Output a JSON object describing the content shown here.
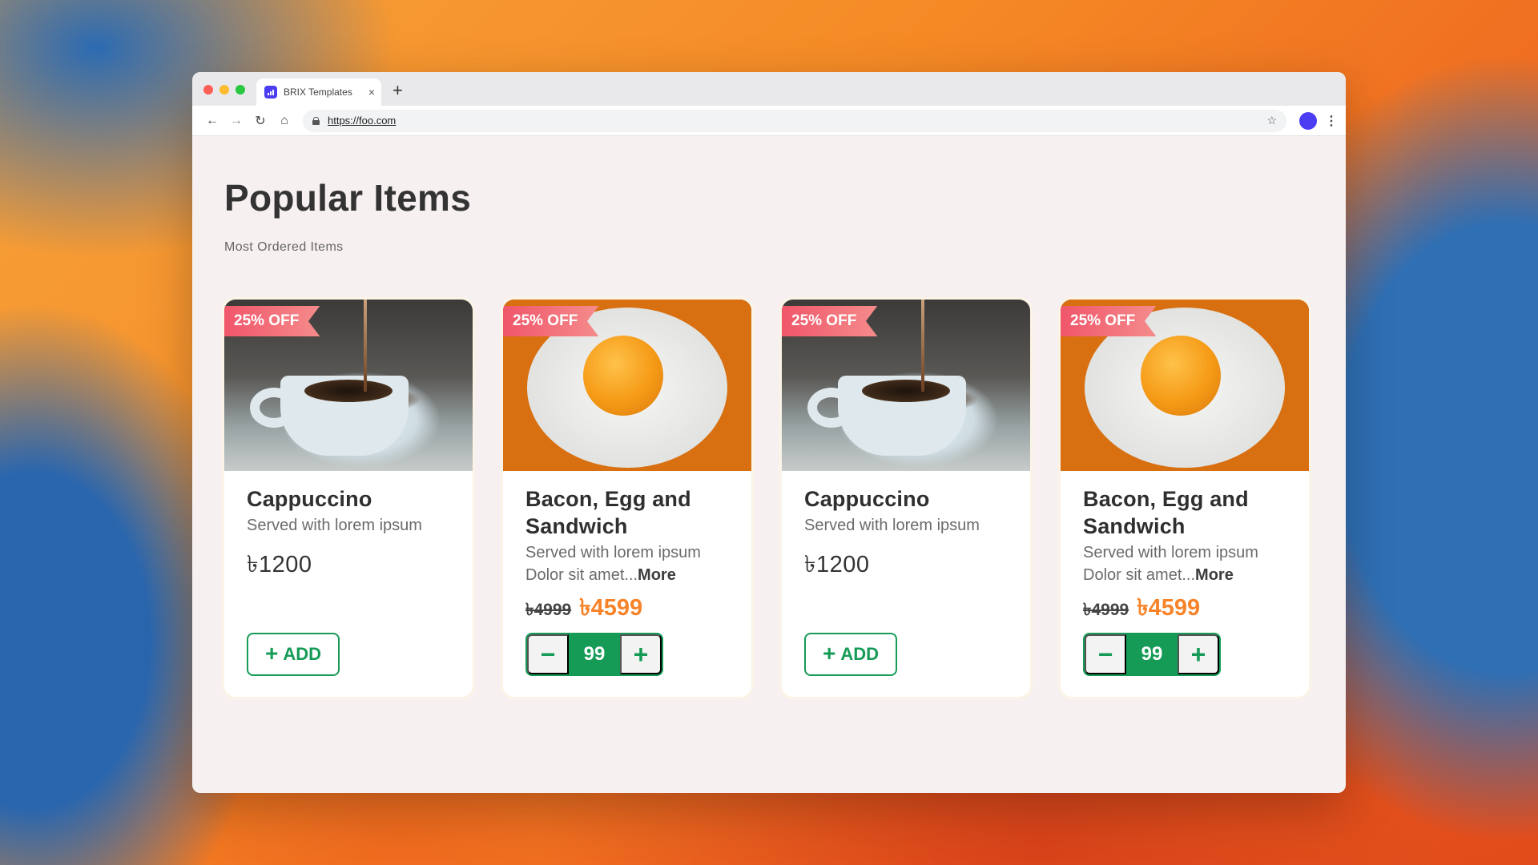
{
  "browser": {
    "tab_title": "BRIX Templates",
    "tab_close": "×",
    "new_tab": "+",
    "url": "https://foo.com",
    "back": "←",
    "forward": "→",
    "reload": "↻",
    "home": "⌂",
    "star": "☆",
    "menu": "⋮"
  },
  "page": {
    "title": "Popular Items",
    "subtitle": "Most Ordered Items"
  },
  "cards": [
    {
      "badge": "25% OFF",
      "image": "coffee",
      "name": "Cappuccino",
      "desc": "Served with lorem ipsum",
      "price": "৳1200",
      "action": {
        "plus": "+",
        "label": "ADD"
      }
    },
    {
      "badge": "25% OFF",
      "image": "egg-sandwich",
      "name": "Bacon, Egg and Sandwich",
      "desc": "Served with lorem ipsum Dolor sit amet...",
      "more": "More",
      "old_price": "৳4999",
      "new_price": "৳4599",
      "stepper": {
        "minus": "−",
        "value": "99",
        "plus": "+"
      }
    },
    {
      "badge": "25% OFF",
      "image": "coffee",
      "name": "Cappuccino",
      "desc": "Served with lorem ipsum",
      "price": "৳1200",
      "action": {
        "plus": "+",
        "label": "ADD"
      }
    },
    {
      "badge": "25% OFF",
      "image": "egg-sandwich",
      "name": "Bacon, Egg and Sandwich",
      "desc": "Served with lorem ipsum Dolor sit amet...",
      "more": "More",
      "old_price": "৳4999",
      "new_price": "৳4599",
      "stepper": {
        "minus": "−",
        "value": "99",
        "plus": "+"
      }
    }
  ],
  "colors": {
    "accent_green": "#169b57",
    "price_orange": "#f7842a",
    "badge_red": "#f0566a",
    "page_bg": "#f6f1f0"
  }
}
